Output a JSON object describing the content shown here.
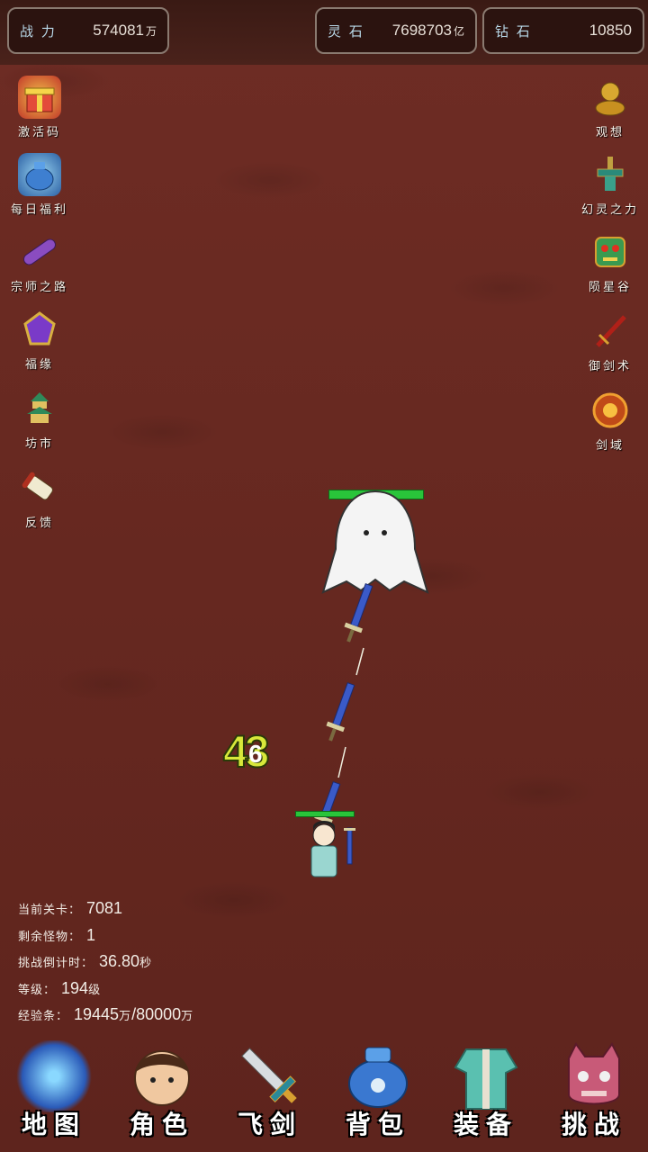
{
  "resources": {
    "power": {
      "label": "战 力",
      "value": "574081",
      "unit": "万"
    },
    "spirit_stone": {
      "label": "灵 石",
      "value": "7698703",
      "unit": "亿"
    },
    "diamond": {
      "label": "钻 石",
      "value": "10850"
    }
  },
  "left_menu": [
    {
      "label": "激活码",
      "icon": "gift-box-icon"
    },
    {
      "label": "每日福利",
      "icon": "lucky-bag-icon"
    },
    {
      "label": "宗师之路",
      "icon": "scroll-icon"
    },
    {
      "label": "福缘",
      "icon": "purple-gem-icon"
    },
    {
      "label": "坊市",
      "icon": "pagoda-icon"
    },
    {
      "label": "反馈",
      "icon": "feedback-scroll-icon"
    }
  ],
  "right_menu": [
    {
      "label": "观想",
      "icon": "golden-statue-icon"
    },
    {
      "label": "幻灵之力",
      "icon": "sword-hilt-icon"
    },
    {
      "label": "陨星谷",
      "icon": "demon-mask-icon"
    },
    {
      "label": "御剑术",
      "icon": "red-sword-icon"
    },
    {
      "label": "剑域",
      "icon": "fire-orb-icon"
    }
  ],
  "battle": {
    "damage_primary": "43",
    "damage_secondary": "6"
  },
  "stats": {
    "stage_label": "当前关卡：",
    "stage_value": "7081",
    "monsters_label": "剩余怪物：",
    "monsters_value": "1",
    "countdown_label": "挑战倒计时：",
    "countdown_value": "36.80",
    "countdown_unit": "秒",
    "level_label": "等级：",
    "level_value": "194",
    "level_unit": "级",
    "exp_label": "经验条：",
    "exp_current": "19445",
    "exp_current_unit": "万",
    "exp_max": "/80000",
    "exp_max_unit": "万"
  },
  "bottom_nav": [
    {
      "label": "地图",
      "icon": "map-globe-icon"
    },
    {
      "label": "角色",
      "icon": "character-portrait-icon"
    },
    {
      "label": "飞剑",
      "icon": "flying-sword-icon"
    },
    {
      "label": "背包",
      "icon": "backpack-bag-icon"
    },
    {
      "label": "装备",
      "icon": "robe-armor-icon"
    },
    {
      "label": "挑战",
      "icon": "demon-face-icon"
    }
  ]
}
